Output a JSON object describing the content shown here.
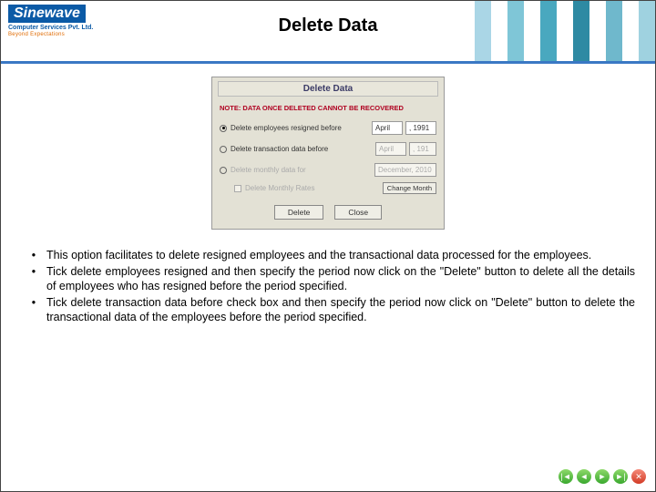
{
  "header": {
    "logo_main": "Sinewave",
    "logo_sub1": "Computer Services Pvt. Ltd.",
    "logo_sub2": "Beyond Expectations",
    "page_title": "Delete Data"
  },
  "dialog": {
    "title": "Delete Data",
    "warning": "NOTE: DATA ONCE DELETED CANNOT BE RECOVERED",
    "row1_label": "Delete employees resigned before",
    "row1_month": "April",
    "row1_year": ", 1991",
    "row2_label": "Delete transaction data before",
    "row2_month": "April",
    "row2_year": ", 191",
    "row3_label": "Delete monthly data  for",
    "row3_value": "December, 2010",
    "row3_sub": "Delete Monthly Rates",
    "change_month": "Change Month",
    "btn_delete": "Delete",
    "btn_close": "Close"
  },
  "bullets": [
    "This option facilitates to delete resigned employees and the transactional data processed for the employees.",
    "Tick delete employees resigned and then specify the period now click on the \"Delete\" button to delete all the details of employees who has resigned before the period specified.",
    "Tick delete transaction data before check box and then specify the period now click on \"Delete\" button to delete the transactional data of the employees before the period specified."
  ],
  "nav": {
    "first": "|◄",
    "prev": "◄",
    "next": "►",
    "last": "►|",
    "close": "✕"
  }
}
